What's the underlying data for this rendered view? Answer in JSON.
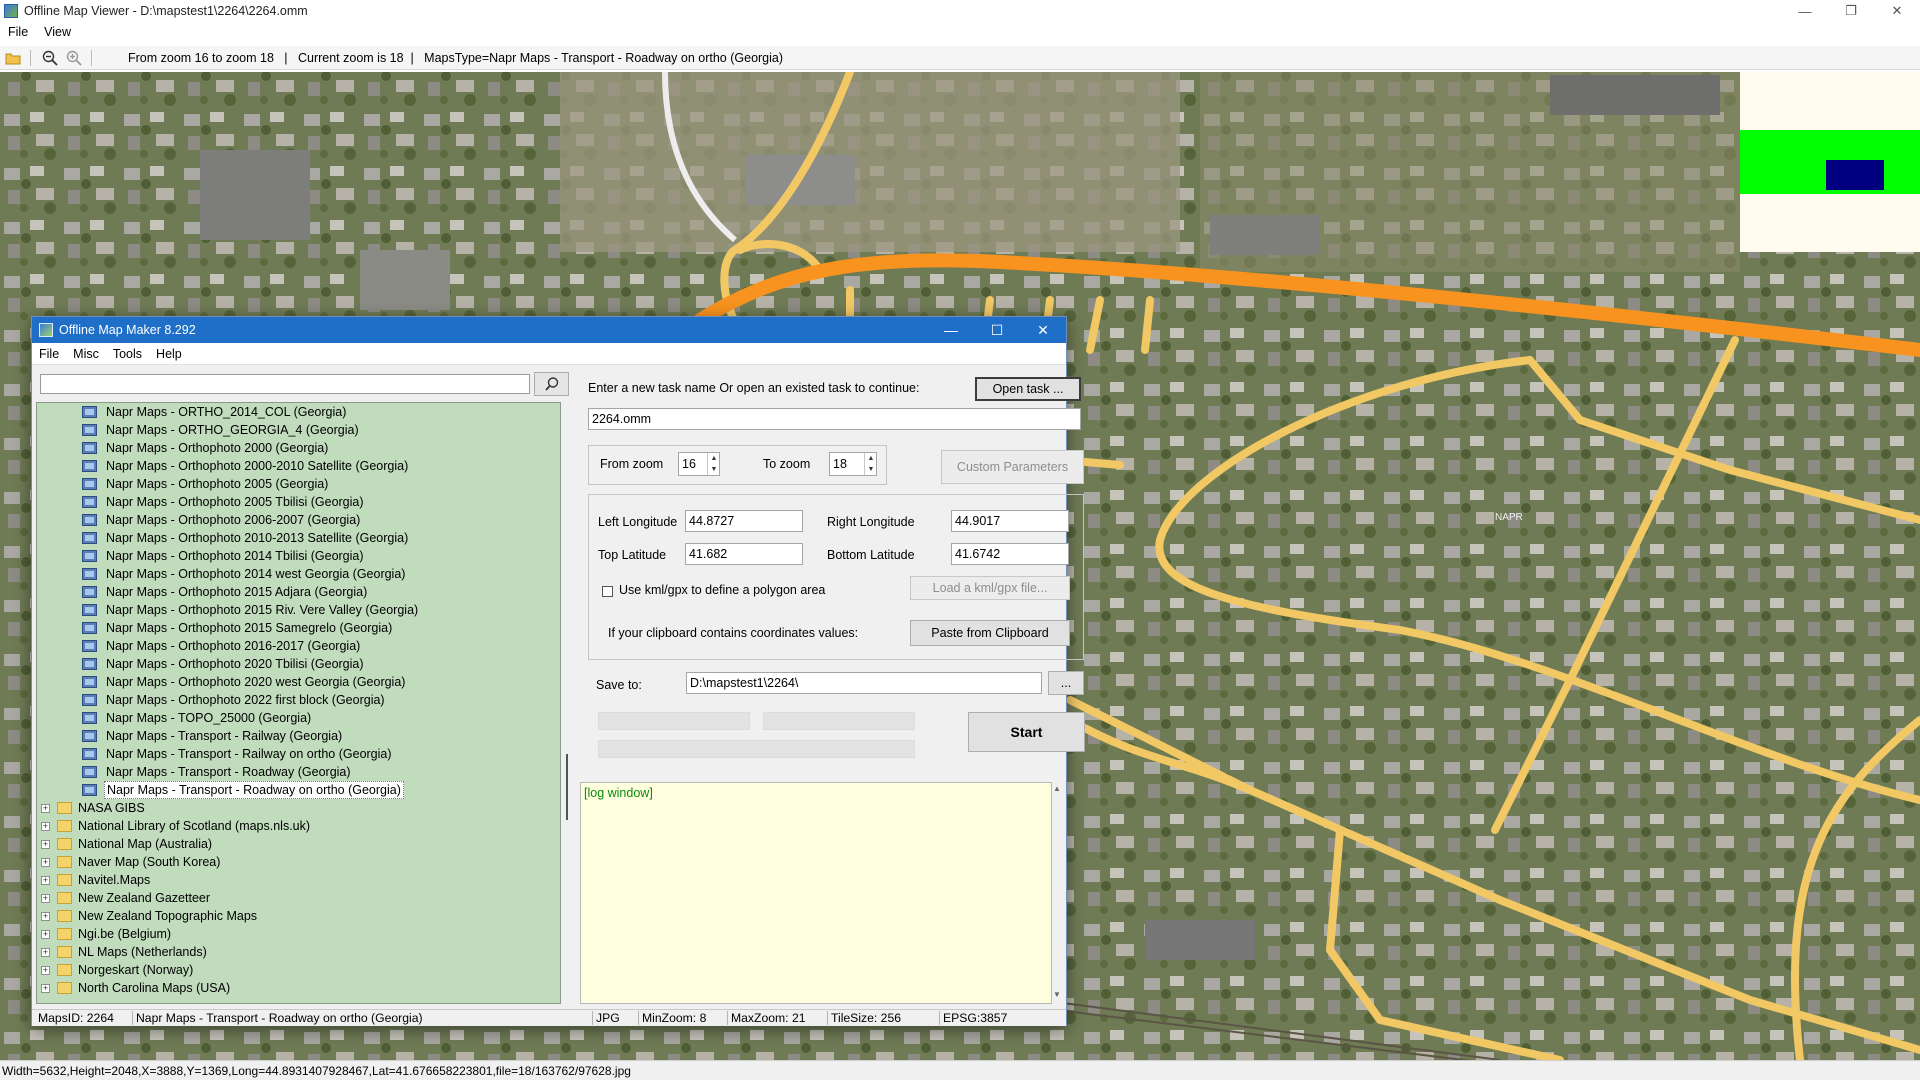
{
  "viewer": {
    "title": "Offline Map Viewer - D:\\mapstest1\\2264\\2264.omm",
    "menu": [
      "File",
      "View"
    ],
    "toolbar_info": "From zoom 16 to zoom 18   |   Current zoom is 18  |   MapsType=Napr Maps - Transport - Roadway on ortho (Georgia)",
    "window_controls": [
      "—",
      "❐",
      "✕"
    ],
    "status": "Width=5632,Height=2048,X=3888,Y=1369,Long=44.8931407928467,Lat=41.676658223801,file=18/163762/97628.jpg",
    "map_label": "NAPR",
    "colors": {
      "road": "#f2c865",
      "highway": "#f7931e",
      "overview_band": "#00ff00",
      "overview_marker": "#000080"
    }
  },
  "maker": {
    "title": "Offline Map Maker 8.292",
    "menu": [
      "File",
      "Misc",
      "Tools",
      "Help"
    ],
    "window_controls": [
      "—",
      "☐",
      "✕"
    ],
    "search": {
      "value": "",
      "placeholder": ""
    },
    "tree": {
      "leaves": [
        "Napr Maps - ORTHO_2014_COL (Georgia)",
        "Napr Maps - ORTHO_GEORGIA_4 (Georgia)",
        "Napr Maps - Orthophoto 2000 (Georgia)",
        "Napr Maps - Orthophoto 2000-2010 Satellite (Georgia)",
        "Napr Maps - Orthophoto 2005 (Georgia)",
        "Napr Maps - Orthophoto 2005 Tbilisi (Georgia)",
        "Napr Maps - Orthophoto 2006-2007 (Georgia)",
        "Napr Maps - Orthophoto 2010-2013 Satellite (Georgia)",
        "Napr Maps - Orthophoto 2014 Tbilisi (Georgia)",
        "Napr Maps - Orthophoto 2014 west Georgia (Georgia)",
        "Napr Maps - Orthophoto 2015 Adjara (Georgia)",
        "Napr Maps - Orthophoto 2015 Riv. Vere Valley (Georgia)",
        "Napr Maps - Orthophoto 2015 Samegrelo (Georgia)",
        "Napr Maps - Orthophoto 2016-2017 (Georgia)",
        "Napr Maps - Orthophoto 2020 Tbilisi (Georgia)",
        "Napr Maps - Orthophoto 2020 west Georgia (Georgia)",
        "Napr Maps - Orthophoto 2022 first block (Georgia)",
        "Napr Maps - TOPO_25000 (Georgia)",
        "Napr Maps - Transport - Railway (Georgia)",
        "Napr Maps - Transport - Railway on ortho (Georgia)",
        "Napr Maps - Transport - Roadway (Georgia)",
        "Napr Maps - Transport - Roadway on ortho (Georgia)"
      ],
      "selected": "Napr Maps - Transport - Roadway on ortho (Georgia)",
      "folders": [
        "NASA GIBS",
        "National Library of Scotland (maps.nls.uk)",
        "National Map (Australia)",
        "Naver Map (South Korea)",
        "Navitel.Maps",
        "New Zealand Gazetteer",
        "New Zealand Topographic Maps",
        "Ngi.be (Belgium)",
        "NL Maps (Netherlands)",
        "Norgeskart (Norway)",
        "North Carolina Maps (USA)"
      ]
    },
    "task": {
      "prompt": "Enter a new task name Or open an existed task to continue:",
      "open_button": "Open task ...",
      "name": "2264.omm"
    },
    "zoom": {
      "from_label": "From zoom",
      "from_value": "16",
      "to_label": "To zoom",
      "to_value": "18",
      "custom_button": "Custom Parameters"
    },
    "coords": {
      "left_lon_label": "Left Longitude",
      "left_lon": "44.8727",
      "right_lon_label": "Right Longitude",
      "right_lon": "44.9017",
      "top_lat_label": "Top Latitude",
      "top_lat": "41.682",
      "bottom_lat_label": "Bottom Latitude",
      "bottom_lat": "41.6742",
      "kml_label": "Use kml/gpx to define a polygon area",
      "kml_checked": false,
      "kml_button": "Load a kml/gpx file...",
      "clipboard_label": "If your clipboard contains coordinates values:",
      "clipboard_button": "Paste from Clipboard"
    },
    "save": {
      "label": "Save to:",
      "path": "D:\\mapstest1\\2264\\",
      "browse": "..."
    },
    "start_button": "Start",
    "log_text": "[log window]",
    "status": {
      "maps_id": "MapsID: 2264",
      "map_name": "Napr Maps - Transport - Roadway on ortho (Georgia)",
      "format": "JPG",
      "min_zoom": "MinZoom: 8",
      "max_zoom": "MaxZoom: 21",
      "tile_size": "TileSize: 256",
      "epsg": "EPSG:3857"
    }
  }
}
